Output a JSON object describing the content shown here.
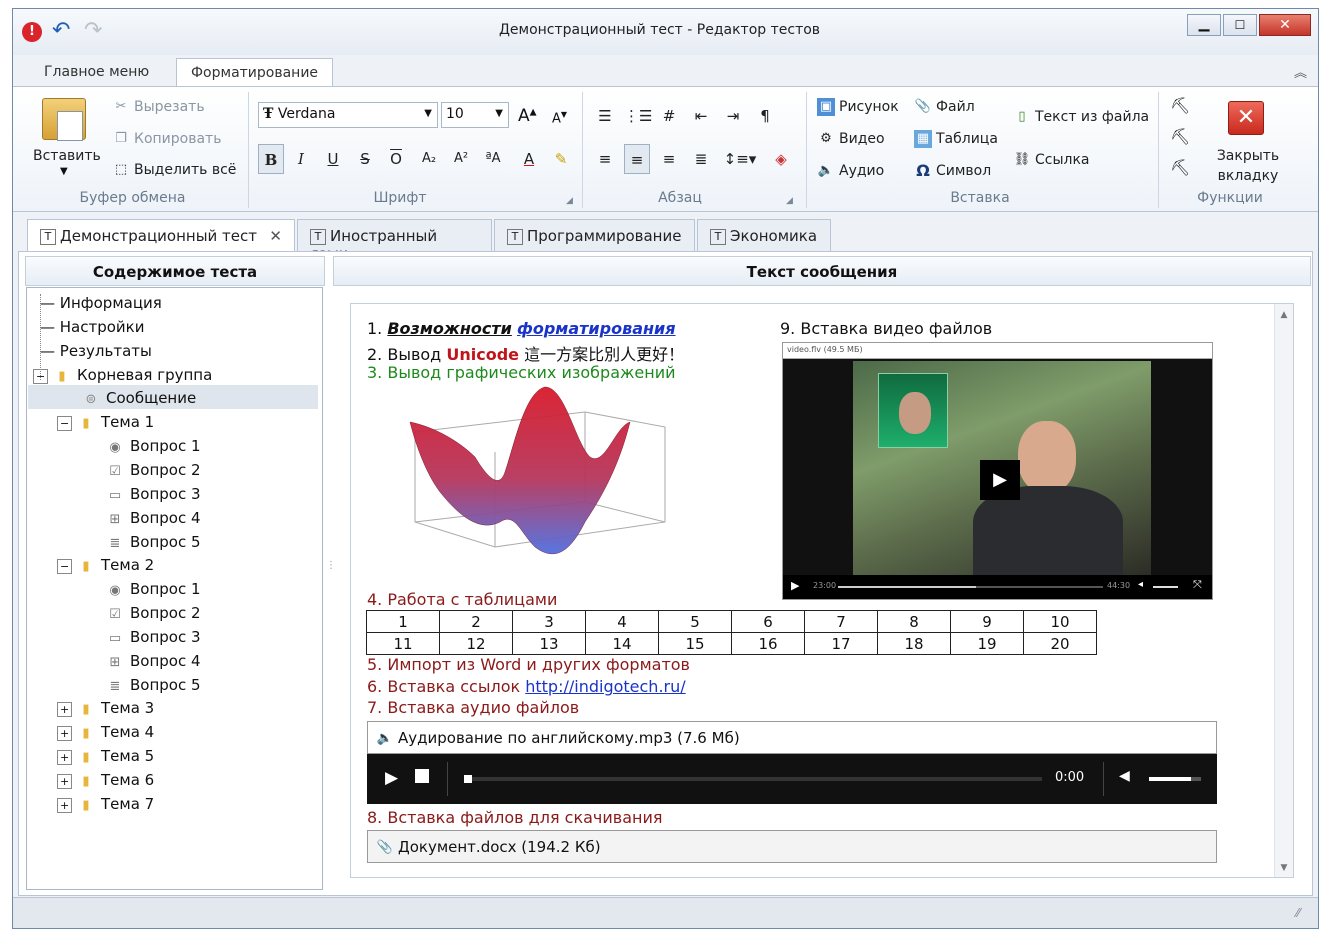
{
  "window": {
    "title": "Демонстрационный тест - Редактор тестов"
  },
  "ribbon_tabs": [
    "Главное меню",
    "Форматирование"
  ],
  "clipboard": {
    "paste": "Вставить",
    "cut": "Вырезать",
    "copy": "Копировать",
    "select_all": "Выделить всё",
    "group": "Буфер обмена"
  },
  "font": {
    "family": "Verdana",
    "size": "10",
    "group": "Шрифт"
  },
  "paragraph": {
    "group": "Абзац"
  },
  "insert": {
    "picture": "Рисунок",
    "video": "Видео",
    "audio": "Аудио",
    "file": "Файл",
    "table": "Таблица",
    "symbol": "Символ",
    "text_from_file": "Текст из файла",
    "link": "Ссылка",
    "group": "Вставка"
  },
  "functions": {
    "close_tab": "Закрыть вкладку",
    "group": "Функции"
  },
  "doc_tabs": [
    "Демонстрационный тест",
    "Иностранный язык",
    "Программирование",
    "Экономика"
  ],
  "left_panel": {
    "title": "Содержимое теста"
  },
  "right_panel": {
    "title": "Текст сообщения"
  },
  "tree": {
    "info": "Информация",
    "settings": "Настройки",
    "results": "Результаты",
    "root": "Корневая группа",
    "message": "Сообщение",
    "topics": [
      "Тема 1",
      "Тема 2",
      "Тема 3",
      "Тема 4",
      "Тема 5",
      "Тема 6",
      "Тема 7"
    ],
    "questions": [
      "Вопрос 1",
      "Вопрос 2",
      "Вопрос 3",
      "Вопрос 4",
      "Вопрос 5"
    ]
  },
  "message": {
    "l1_num": "1.",
    "l1_a": "Возможности",
    "l1_b": "форматирования",
    "l2_a": "2. Вывод",
    "l2_b": "Unicode",
    "l2_c": "這一方案比別人更好！",
    "l3": "3. Вывод графических изображений",
    "l4": "4. Работа с таблицами",
    "table": [
      [
        "1",
        "2",
        "3",
        "4",
        "5",
        "6",
        "7",
        "8",
        "9",
        "10"
      ],
      [
        "11",
        "12",
        "13",
        "14",
        "15",
        "16",
        "17",
        "18",
        "19",
        "20"
      ]
    ],
    "l5": "5. Импорт из Word и других форматов",
    "l6": "6. Вставка ссылок",
    "l6_link": "http://indigotech.ru/",
    "l7": "7. Вставка аудио файлов",
    "audio_name": "Аудирование по английскому.mp3 (7.6 Мб)",
    "audio_time": "0:00",
    "l8": "8. Вставка файлов для скачивания",
    "doc_name": "Документ.docx (194.2 Кб)",
    "l9": "9. Вставка видео файлов",
    "video_title": "video.flv (49.5 МБ)",
    "video_start": "23:00",
    "video_end": "44:30"
  },
  "colors": {
    "accent_red": "#c0141a",
    "link_blue": "#1a33c9",
    "green": "#1e8a1e",
    "maroon": "#8b1a1a"
  }
}
